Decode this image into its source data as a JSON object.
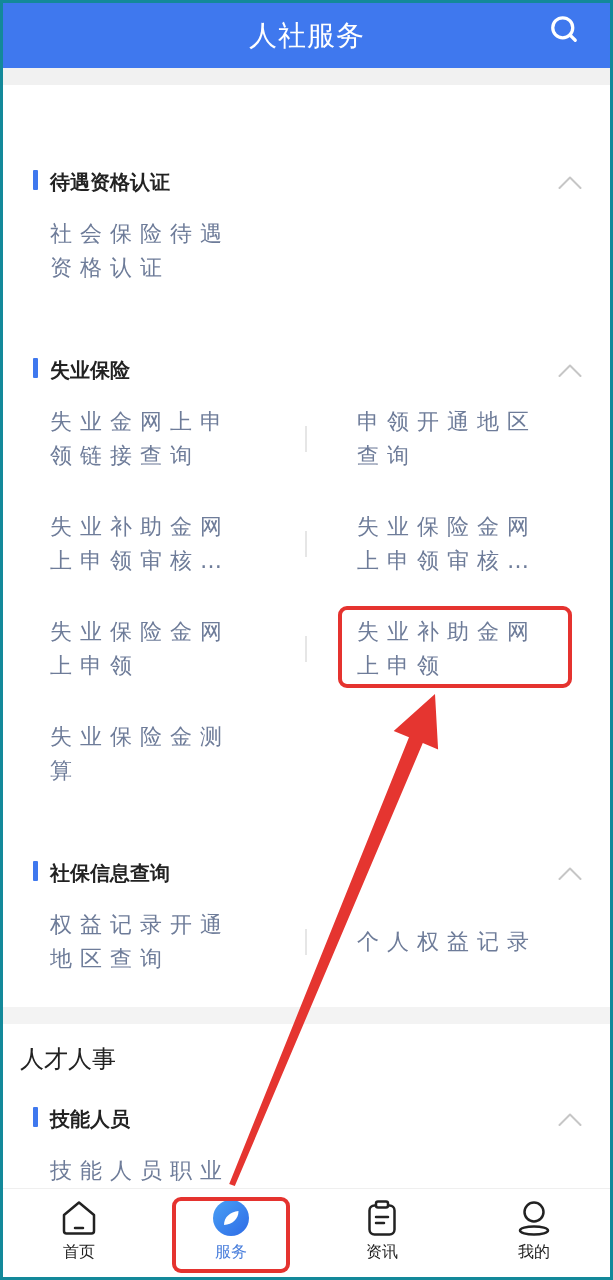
{
  "header": {
    "title": "人社服务"
  },
  "groups": [
    {
      "sections": [
        {
          "title": "待遇资格认证",
          "expanded": true,
          "items": [
            {
              "label": "社会保险待遇资格认证",
              "annotated": false
            }
          ]
        },
        {
          "title": "失业保险",
          "expanded": true,
          "items": [
            {
              "label": "失业金网上申领链接查询",
              "annotated": false
            },
            {
              "label": "申领开通地区查询",
              "annotated": false
            },
            {
              "label": "失业补助金网上申领审核…",
              "annotated": false
            },
            {
              "label": "失业保险金网上申领审核…",
              "annotated": false
            },
            {
              "label": "失业保险金网上申领",
              "annotated": false
            },
            {
              "label": "失业补助金网上申领",
              "annotated": true
            },
            {
              "label": "失业保险金测算",
              "annotated": false
            }
          ]
        },
        {
          "title": "社保信息查询",
          "expanded": true,
          "items": [
            {
              "label": "权益记录开通地区查询",
              "annotated": false
            },
            {
              "label": "个人权益记录",
              "annotated": false
            }
          ]
        }
      ]
    },
    {
      "title": "人才人事",
      "sections": [
        {
          "title": "技能人员",
          "expanded": true,
          "items": [
            {
              "label": "技能人员职业",
              "annotated": false
            }
          ]
        }
      ]
    }
  ],
  "tabs": [
    {
      "kind": "home",
      "label": "首页",
      "selected": false,
      "annotated": false
    },
    {
      "kind": "services",
      "label": "服务",
      "selected": true,
      "annotated": true
    },
    {
      "kind": "news",
      "label": "资讯",
      "selected": false,
      "annotated": false
    },
    {
      "kind": "profile",
      "label": "我的",
      "selected": false,
      "annotated": false
    }
  ]
}
